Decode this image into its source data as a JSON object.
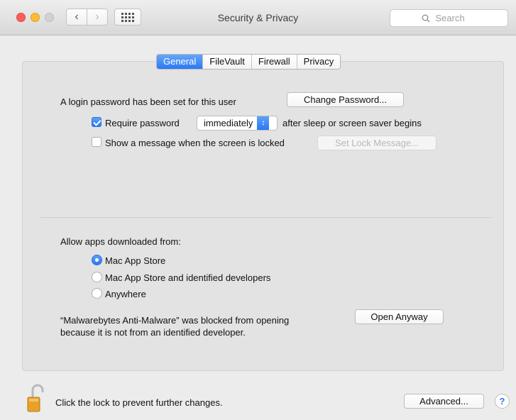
{
  "window": {
    "title": "Security & Privacy",
    "search_placeholder": "Search"
  },
  "tabs": [
    {
      "label": "General",
      "active": true
    },
    {
      "label": "FileVault",
      "active": false
    },
    {
      "label": "Firewall",
      "active": false
    },
    {
      "label": "Privacy",
      "active": false
    }
  ],
  "general": {
    "login_text": "A login password has been set for this user",
    "change_password_label": "Change Password...",
    "require_password_label": "Require password",
    "require_password_checked": true,
    "require_password_value": "immediately",
    "after_sleep_text": "after sleep or screen saver begins",
    "show_message_label": "Show a message when the screen is locked",
    "show_message_checked": false,
    "set_lock_message_label": "Set Lock Message..."
  },
  "downloads": {
    "heading": "Allow apps downloaded from:",
    "options": [
      {
        "label": "Mac App Store",
        "selected": true
      },
      {
        "label": "Mac App Store and identified developers",
        "selected": false
      },
      {
        "label": "Anywhere",
        "selected": false
      }
    ],
    "blocked_line1": "“Malwarebytes Anti-Malware” was blocked from opening",
    "blocked_line2": "because it is not from an identified developer.",
    "open_anyway_label": "Open Anyway"
  },
  "footer": {
    "lock_text": "Click the lock to prevent further changes.",
    "advanced_label": "Advanced...",
    "help_label": "?"
  },
  "colors": {
    "accent": "#2a78f3",
    "panel": "#e3e3e3",
    "window": "#ececec"
  }
}
